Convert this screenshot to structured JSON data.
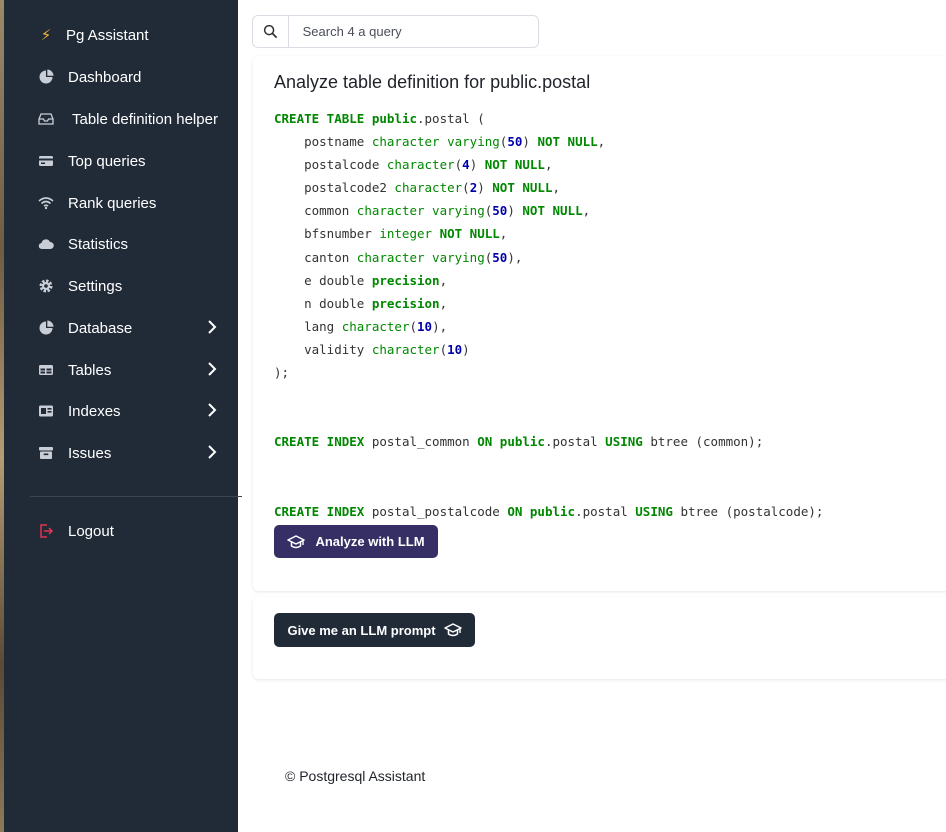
{
  "app": {
    "brand": "Pg Assistant"
  },
  "sidebar": {
    "items": [
      {
        "label": "Dashboard",
        "icon": "pie-chart-icon"
      },
      {
        "label": "Table definition helper",
        "icon": "tray-icon"
      },
      {
        "label": "Top queries",
        "icon": "card-icon"
      },
      {
        "label": "Rank queries",
        "icon": "wifi-icon"
      },
      {
        "label": "Statistics",
        "icon": "cloud-icon"
      },
      {
        "label": "Settings",
        "icon": "gear-icon"
      },
      {
        "label": "Database",
        "icon": "pie-chart-icon",
        "expandable": true
      },
      {
        "label": "Tables",
        "icon": "table-icon",
        "expandable": true
      },
      {
        "label": "Indexes",
        "icon": "index-icon",
        "expandable": true
      },
      {
        "label": "Issues",
        "icon": "archive-icon",
        "expandable": true
      }
    ],
    "logout": {
      "label": "Logout",
      "icon": "logout-icon"
    }
  },
  "search": {
    "placeholder": "Search 4 a query",
    "value": ""
  },
  "main": {
    "title": "Analyze table definition for public.postal",
    "analyze_button": "Analyze with LLM",
    "prompt_button": "Give me an LLM prompt"
  },
  "footer": {
    "text": "© Postgresql Assistant"
  },
  "colors": {
    "sidebar": "#212b38",
    "accent": "#352f65",
    "bolt": "#f4b533",
    "logout": "#e0344f"
  }
}
